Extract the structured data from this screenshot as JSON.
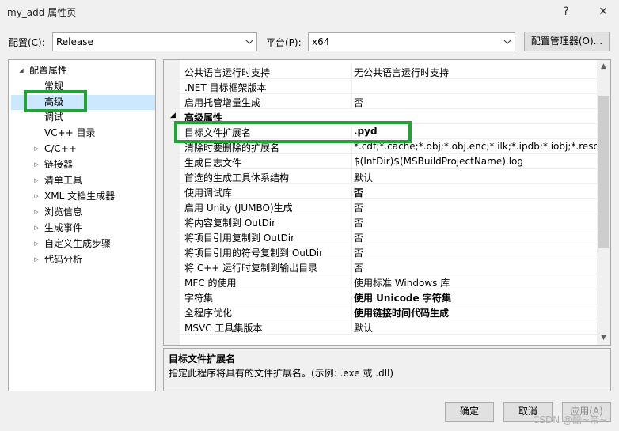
{
  "window": {
    "title": "my_add 属性页",
    "help": "?",
    "close": "✕"
  },
  "config": {
    "config_label": "配置(C):",
    "config_value": "Release",
    "platform_label": "平台(P):",
    "platform_value": "x64",
    "manager_button": "配置管理器(O)..."
  },
  "tree": {
    "root": "配置属性",
    "items": [
      "常规",
      "高级",
      "调试",
      "VC++ 目录",
      "C/C++",
      "链接器",
      "清单工具",
      "XML 文档生成器",
      "浏览信息",
      "生成事件",
      "自定义生成步骤",
      "代码分析"
    ],
    "selected": "高级"
  },
  "grid": {
    "rows": [
      {
        "name": "公共语言运行时支持",
        "value": "无公共语言运行时支持"
      },
      {
        "name": ".NET 目标框架版本",
        "value": ""
      },
      {
        "name": "启用托管增量生成",
        "value": "否"
      },
      {
        "category": "高级属性"
      },
      {
        "name": "目标文件扩展名",
        "value": ".pyd"
      },
      {
        "name": "清除时要删除的扩展名",
        "value": "*.cdf;*.cache;*.obj;*.obj.enc;*.ilk;*.ipdb;*.iobj;*.resources;"
      },
      {
        "name": "生成日志文件",
        "value": "$(IntDir)$(MSBuildProjectName).log"
      },
      {
        "name": "首选的生成工具体系结构",
        "value": "默认"
      },
      {
        "name": "使用调试库",
        "value": "否"
      },
      {
        "name": "启用 Unity (JUMBO)生成",
        "value": "否"
      },
      {
        "name": "将内容复制到 OutDir",
        "value": "否"
      },
      {
        "name": "将项目引用复制到 OutDir",
        "value": "否"
      },
      {
        "name": "将项目引用的符号复制到 OutDir",
        "value": "否"
      },
      {
        "name": "将 C++ 运行时复制到输出目录",
        "value": "否"
      },
      {
        "name": "MFC 的使用",
        "value": "使用标准 Windows 库"
      },
      {
        "name": "字符集",
        "value": "使用 Unicode 字符集"
      },
      {
        "name": "全程序优化",
        "value": "使用链接时间代码生成"
      },
      {
        "name": "MSVC 工具集版本",
        "value": "默认"
      }
    ]
  },
  "description": {
    "title": "目标文件扩展名",
    "text": "指定此程序将具有的文件扩展名。(示例: .exe 或 .dll)"
  },
  "buttons": {
    "ok": "确定",
    "cancel": "取消",
    "apply": "应用(A)"
  },
  "watermark": "CSDN @酷~帝~",
  "colors": {
    "highlight": "#23a336",
    "selection": "#cce8ff"
  }
}
